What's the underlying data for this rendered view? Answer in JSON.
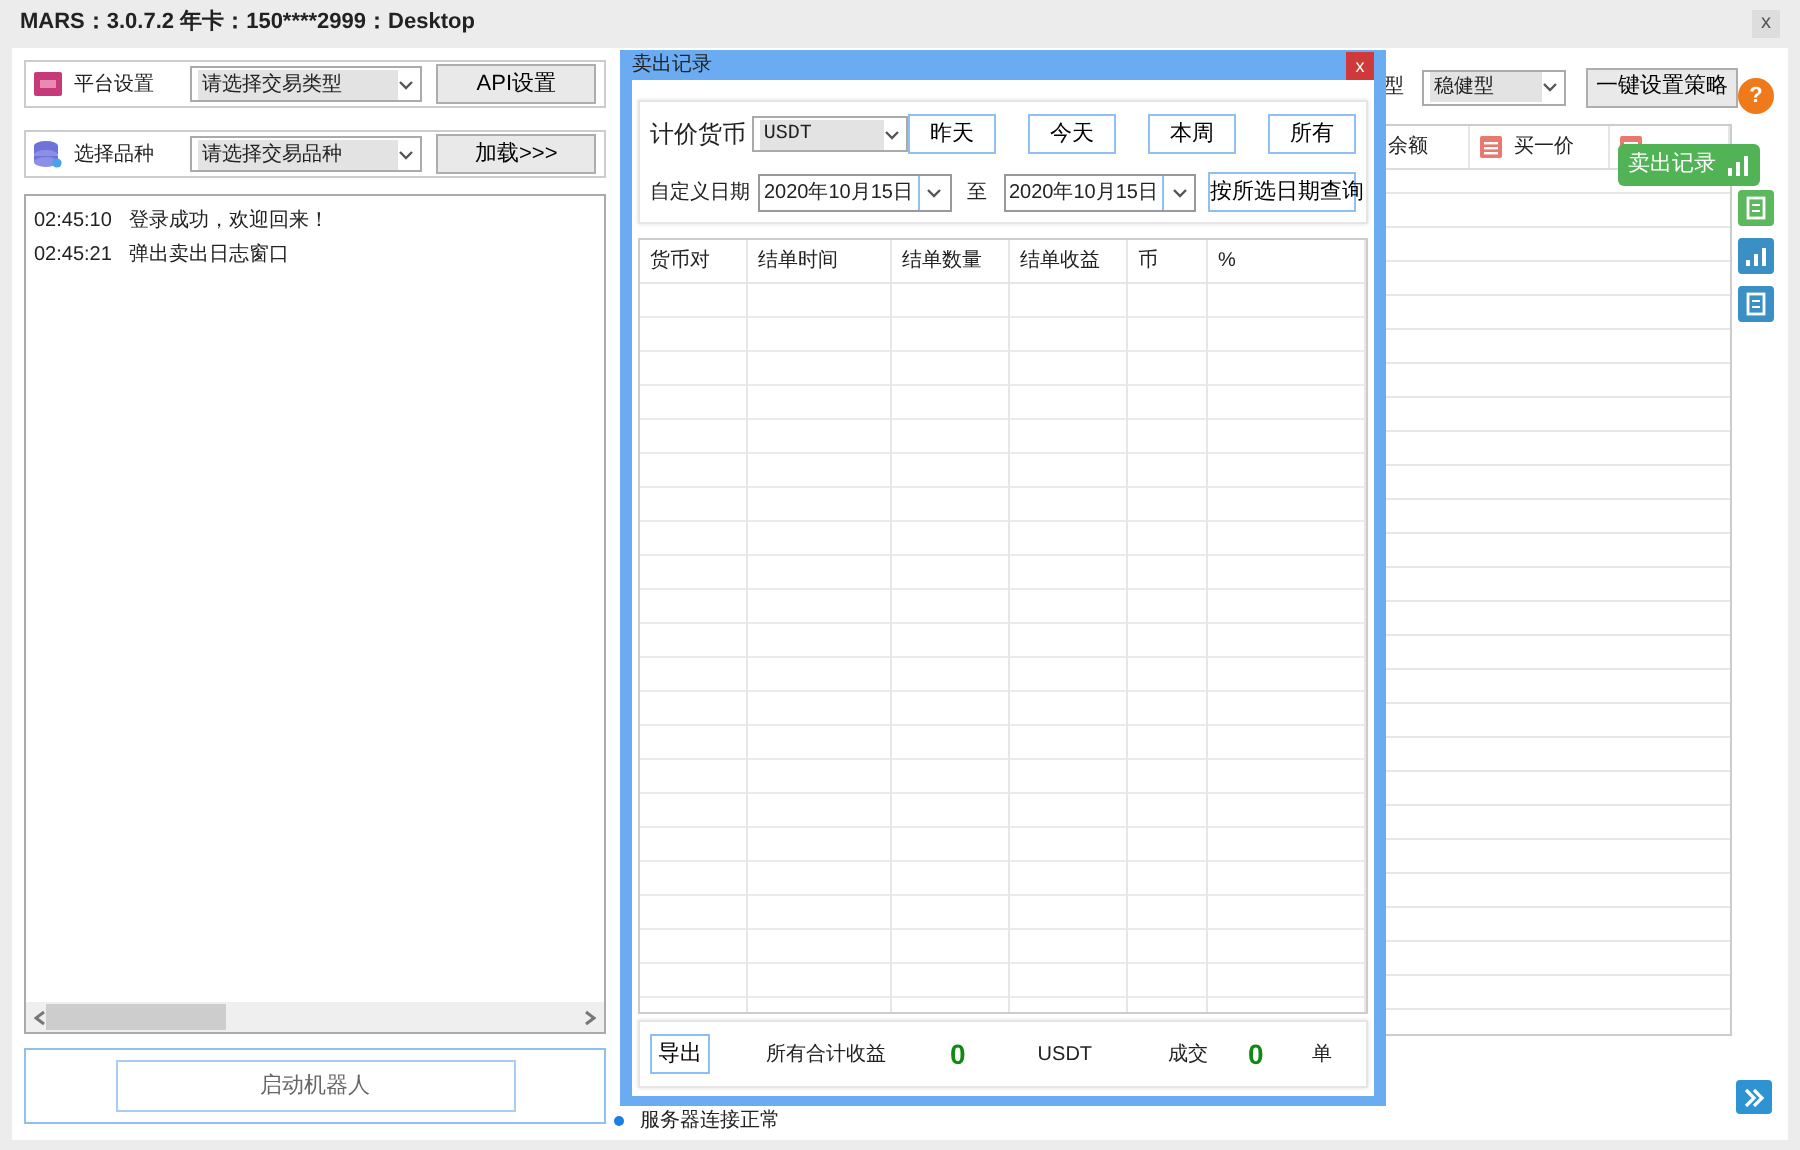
{
  "window": {
    "title": "MARS：3.0.7.2  年卡：150****2999：Desktop",
    "close": "x"
  },
  "left_panel": {
    "platform": {
      "label": "平台设置",
      "select": "请选择交易类型",
      "button": "API设置"
    },
    "symbol": {
      "label": "选择品种",
      "select": "请选择交易品种",
      "button": "加载>>>"
    },
    "log": [
      {
        "time": "02:45:10",
        "message": "登录成功，欢迎回来！"
      },
      {
        "time": "02:45:21",
        "message": "弹出卖出日志窗口"
      }
    ],
    "start_button": "启动机器人"
  },
  "status": "服务器连接正常",
  "background_panel": {
    "type_label": "型",
    "strategy_select": "稳健型",
    "strategy_button": "一键设置策略",
    "columns": [
      {
        "label": "余额",
        "icon": false
      },
      {
        "label": "买一价",
        "icon": true
      },
      {
        "icon": true
      }
    ]
  },
  "side_toolbar": {
    "help": "?",
    "tooltip": "卖出记录"
  },
  "dialog": {
    "title": "卖出记录",
    "close": "x",
    "currency_label": "计价货币",
    "currency": "USDT",
    "range_buttons": [
      "昨天",
      "今天",
      "本周",
      "所有"
    ],
    "date_label": "自定义日期",
    "date_from": "2020年10月15日",
    "to_label": "至",
    "date_to": "2020年10月15日",
    "query_button": "按所选日期查询",
    "columns": [
      "货币对",
      "结单时间",
      "结单数量",
      "结单收益",
      "币",
      "%"
    ],
    "footer": {
      "export": "导出",
      "total_label": "所有合计收益",
      "total": "0",
      "unit": "USDT",
      "deals_label": "成交",
      "deals": "0",
      "deals_unit": "单"
    }
  }
}
